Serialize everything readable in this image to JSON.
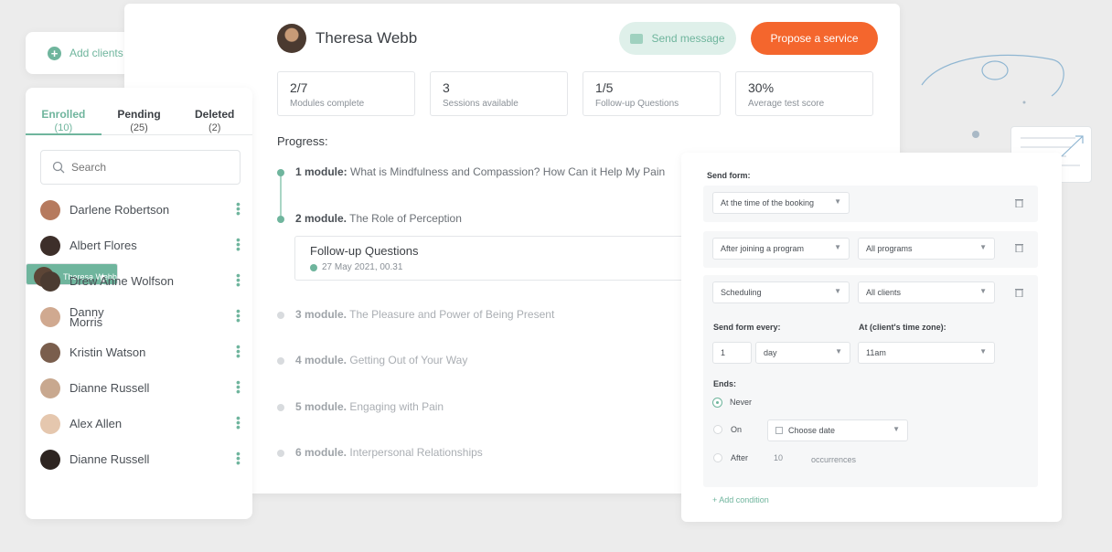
{
  "add_clients": {
    "label": "Add clients"
  },
  "tabs": [
    {
      "label": "Enrolled",
      "count": "(10)"
    },
    {
      "label": "Pending",
      "count": "(25)"
    },
    {
      "label": "Deleted",
      "count": "(2)"
    }
  ],
  "search": {
    "placeholder": "Search"
  },
  "clients": [
    {
      "name": "Darlene Robertson",
      "avatar_color": "#b67a5e"
    },
    {
      "name": "Albert Flores",
      "avatar_color": "#3d2f2a"
    },
    {
      "name": "Theresa Webb",
      "avatar_color": "#5c4536"
    },
    {
      "name": "Drew Anne Wolfson",
      "avatar_color": "#4b3b31"
    },
    {
      "name": "Danny",
      "name2": "Morris",
      "avatar_color": "#d0a990"
    },
    {
      "name": "Kristin Watson",
      "avatar_color": "#7a5e4d"
    },
    {
      "name": "Dianne Russell",
      "avatar_color": "#c8a88f"
    },
    {
      "name": "Alex Allen",
      "avatar_color": "#e5c7ae"
    },
    {
      "name": "Dianne Russell",
      "avatar_color": "#2e2521"
    }
  ],
  "profile": {
    "name": "Theresa Webb"
  },
  "buttons": {
    "send_message": "Send message",
    "propose_service": "Propose a service"
  },
  "stats": [
    {
      "value": "2/7",
      "label": "Modules complete"
    },
    {
      "value": "3",
      "label": "Sessions available"
    },
    {
      "value": "1/5",
      "label": "Follow-up Questions"
    },
    {
      "value": "30%",
      "label": "Average test score"
    }
  ],
  "progress_label": "Progress:",
  "modules": [
    {
      "num": "1 module:",
      "title": "What is Mindfulness and Compassion? How Can it Help My Pain",
      "done": true
    },
    {
      "num": "2 module.",
      "title": "The Role of Perception",
      "done": true
    },
    {
      "num": "3 module.",
      "title": "The Pleasure and Power of Being Present",
      "done": false
    },
    {
      "num": "4 module.",
      "title": "Getting Out of Your Way",
      "done": false
    },
    {
      "num": "5 module.",
      "title": "Engaging with Pain",
      "done": false
    },
    {
      "num": "6 module.",
      "title": "Interpersonal Relationships",
      "done": false
    }
  ],
  "followup": {
    "title": "Follow-up Questions",
    "date": "27 May 2021, 00.31"
  },
  "form": {
    "title": "Send form:",
    "rule1": {
      "trigger": "At the time of the booking"
    },
    "rule2": {
      "trigger": "After joining a program",
      "scope": "All programs"
    },
    "rule3": {
      "trigger": "Scheduling",
      "scope": "All clients"
    },
    "every_label": "Send form every:",
    "tz_label": "At (client's time zone):",
    "every_num": "1",
    "every_unit": "day",
    "time": "11am",
    "ends_label": "Ends:",
    "never": "Never",
    "on": "On",
    "choose_date": "Choose date",
    "after": "After",
    "after_num": "10",
    "occurrences": "occurrences",
    "add_condition": "Add condition"
  }
}
